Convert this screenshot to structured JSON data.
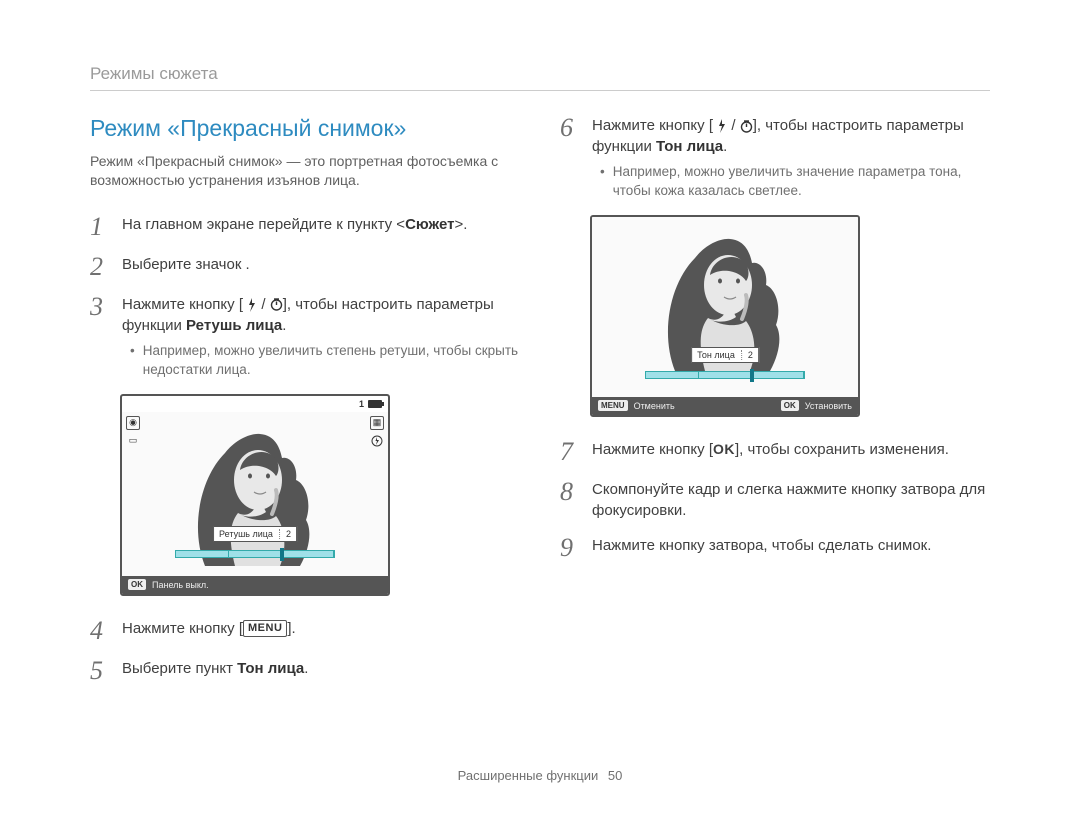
{
  "header": "Режимы сюжета",
  "left": {
    "title": "Режим «Прекрасный снимок»",
    "intro": "Режим «Прекрасный снимок» — это портретная фотосъемка с возможностью устранения изъянов лица.",
    "steps": {
      "s1_pre": "На главном экране перейдите к пункту <",
      "s1_bold": "Сюжет",
      "s1_post": ">.",
      "s2": "Выберите значок      .",
      "s3_pre": "Нажмите кнопку [",
      "s3_post": "], чтобы настроить параметры функции ",
      "s3_bold": "Ретушь лица",
      "s3_end": ".",
      "s3_bullet": "Например, можно увеличить степень ретуши, чтобы скрыть недостатки лица.",
      "s4_pre": "Нажмите кнопку [",
      "s4_post": "].",
      "s5_pre": "Выберите пункт ",
      "s5_bold": "Тон лица",
      "s5_post": "."
    },
    "step_nums": {
      "n1": "1",
      "n2": "2",
      "n3": "3",
      "n4": "4",
      "n5": "5"
    },
    "lcd": {
      "param_label": "Ретушь лица",
      "param_value": "2",
      "foot_ok": "OK",
      "foot_label": "Панель выкл.",
      "top_one": "1"
    }
  },
  "right": {
    "steps": {
      "s6_pre": "Нажмите кнопку [",
      "s6_post": "], чтобы настроить параметры функции ",
      "s6_bold": "Тон лица",
      "s6_end": ".",
      "s6_bullet": "Например, можно увеличить значение параметра тона, чтобы кожа казалась светлее.",
      "s7_pre": "Нажмите кнопку [",
      "s7_post": "], чтобы сохранить изменения.",
      "s8": "Скомпонуйте кадр и слегка нажмите кнопку затвора для фокусировки.",
      "s9": "Нажмите кнопку затвора, чтобы сделать снимок."
    },
    "step_nums": {
      "n6": "6",
      "n7": "7",
      "n8": "8",
      "n9": "9"
    },
    "lcd": {
      "param_label": "Тон лица",
      "param_value": "2",
      "foot_menu": "MENU",
      "foot_cancel": "Отменить",
      "foot_ok": "OK",
      "foot_set": "Установить"
    }
  },
  "glyphs": {
    "menu": "MENU",
    "ok": "OK"
  },
  "footer": {
    "section": "Расширенные функции",
    "page": "50"
  }
}
